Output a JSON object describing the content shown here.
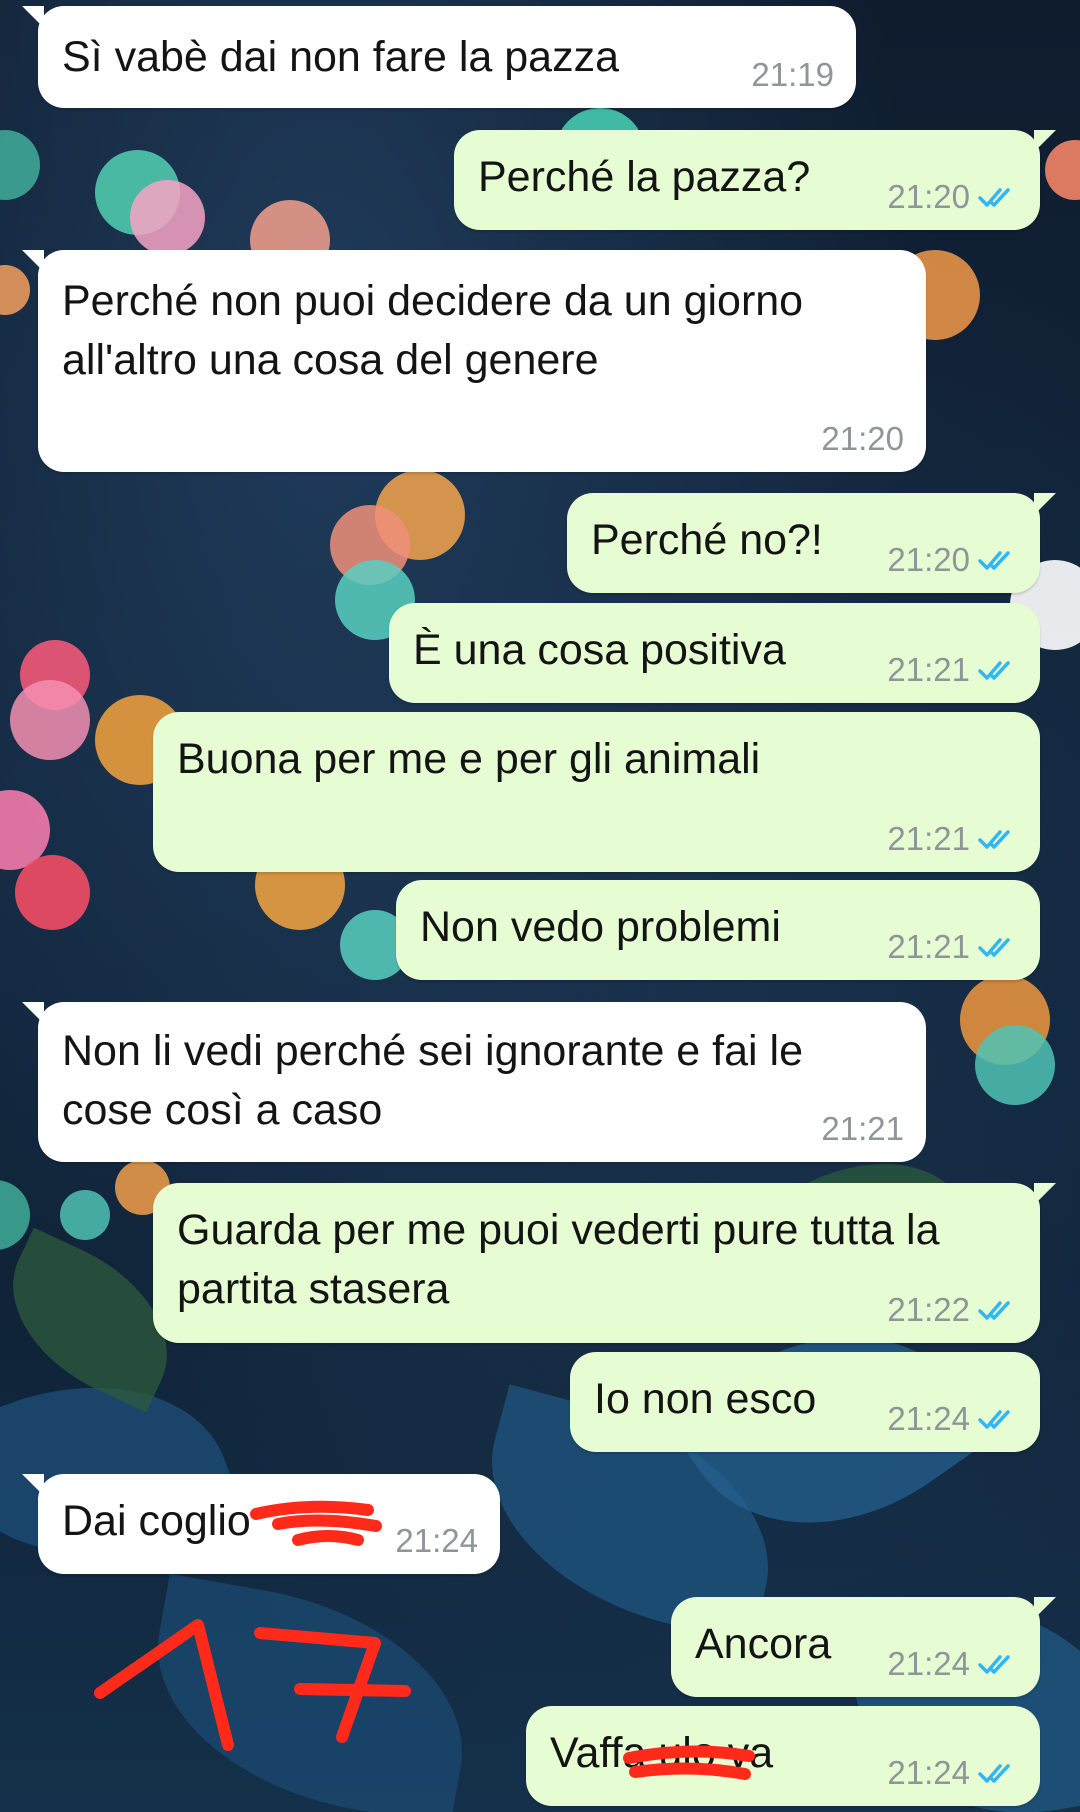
{
  "chat": {
    "messages": [
      {
        "direction": "incoming",
        "text": "Sì vabè dai non fare la pazza",
        "time": "21:19"
      },
      {
        "direction": "outgoing",
        "text": "Perché la pazza?",
        "time": "21:20",
        "status": "read"
      },
      {
        "direction": "incoming",
        "text": "Perché non puoi decidere da un giorno all'altro una cosa del genere",
        "time": "21:20"
      },
      {
        "direction": "outgoing",
        "text": "Perché no?!",
        "time": "21:20",
        "status": "read"
      },
      {
        "direction": "outgoing",
        "text": "È una cosa positiva",
        "time": "21:21",
        "status": "read"
      },
      {
        "direction": "outgoing",
        "text": "Buona per me e per gli animali",
        "time": "21:21",
        "status": "read"
      },
      {
        "direction": "outgoing",
        "text": "Non vedo problemi",
        "time": "21:21",
        "status": "read"
      },
      {
        "direction": "incoming",
        "text": "Non li vedi perché sei ignorante e fai le cose così a caso",
        "time": "21:21"
      },
      {
        "direction": "outgoing",
        "text": "Guarda per me puoi vederti pure tutta la partita stasera",
        "time": "21:22",
        "status": "read"
      },
      {
        "direction": "outgoing",
        "text": "Io non esco",
        "time": "21:24",
        "status": "read"
      },
      {
        "direction": "incoming",
        "text": "Dai coglio",
        "time": "21:24"
      },
      {
        "direction": "outgoing",
        "text": "Ancora",
        "time": "21:24",
        "status": "read"
      },
      {
        "direction": "outgoing",
        "text": "Vaffa ulo va",
        "time": "21:24",
        "status": "read"
      }
    ]
  },
  "annotation": {
    "text": "17",
    "color": "#ff2a1a"
  },
  "colors": {
    "incoming_bubble": "#ffffff",
    "outgoing_bubble": "#e6fcd3",
    "read_check": "#34b7f1",
    "time": "#8f9697"
  },
  "icons": {
    "read_receipt": "double-check-icon"
  }
}
